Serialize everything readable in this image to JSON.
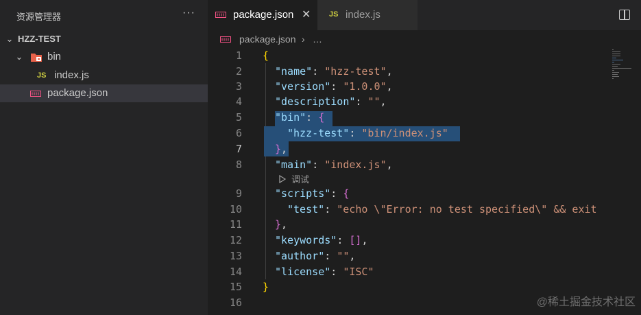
{
  "sidebar": {
    "title": "资源管理器",
    "more": "···",
    "root": "HZZ-TEST",
    "folder": "bin",
    "files": [
      {
        "badge": "JS",
        "name": "index.js"
      },
      {
        "name": "package.json"
      }
    ]
  },
  "tabs": [
    {
      "name": "package.json",
      "close": "✕"
    },
    {
      "badge": "JS",
      "name": "index.js"
    }
  ],
  "breadcrumb": {
    "file": "package.json",
    "sep": "›",
    "more": "…"
  },
  "editor": {
    "line_numbers": [
      "1",
      "2",
      "3",
      "4",
      "5",
      "6",
      "7",
      "8",
      "9",
      "10",
      "11",
      "12",
      "13",
      "14",
      "15",
      "16"
    ],
    "codelens": "调试",
    "lines": {
      "l1": {
        "brace": "{"
      },
      "l2": {
        "key": "\"name\"",
        "colon": ": ",
        "val": "\"hzz-test\"",
        "comma": ","
      },
      "l3": {
        "key": "\"version\"",
        "colon": ": ",
        "val": "\"1.0.0\"",
        "comma": ","
      },
      "l4": {
        "key": "\"description\"",
        "colon": ": ",
        "val": "\"\"",
        "comma": ","
      },
      "l5": {
        "key": "\"bin\"",
        "colon": ": ",
        "brace": "{"
      },
      "l6": {
        "key": "\"hzz-test\"",
        "colon": ": ",
        "val": "\"bin/index.js\""
      },
      "l7": {
        "brace": "}",
        "comma": ","
      },
      "l8": {
        "key": "\"main\"",
        "colon": ": ",
        "val": "\"index.js\"",
        "comma": ","
      },
      "l9": {
        "key": "\"scripts\"",
        "colon": ": ",
        "brace": "{"
      },
      "l10": {
        "key": "\"test\"",
        "colon": ": ",
        "val": "\"echo \\\"Error: no test specified\\\" && exit"
      },
      "l11": {
        "brace": "}",
        "comma": ","
      },
      "l12": {
        "key": "\"keywords\"",
        "colon": ": ",
        "val": "[]",
        "comma": ","
      },
      "l13": {
        "key": "\"author\"",
        "colon": ": ",
        "val": "\"\"",
        "comma": ","
      },
      "l14": {
        "key": "\"license\"",
        "colon": ": ",
        "val": "\"ISC\""
      },
      "l15": {
        "brace": "}"
      }
    }
  },
  "colors": {
    "accent": "#0078d4",
    "selection": "#264f78",
    "key": "#9cdcfe",
    "string": "#ce9178",
    "brace_outer": "#ffd700",
    "brace_inner": "#da70d6",
    "js_badge": "#cbcb41",
    "json_icon": "#f55385"
  },
  "watermark": "@稀土掘金技术社区"
}
